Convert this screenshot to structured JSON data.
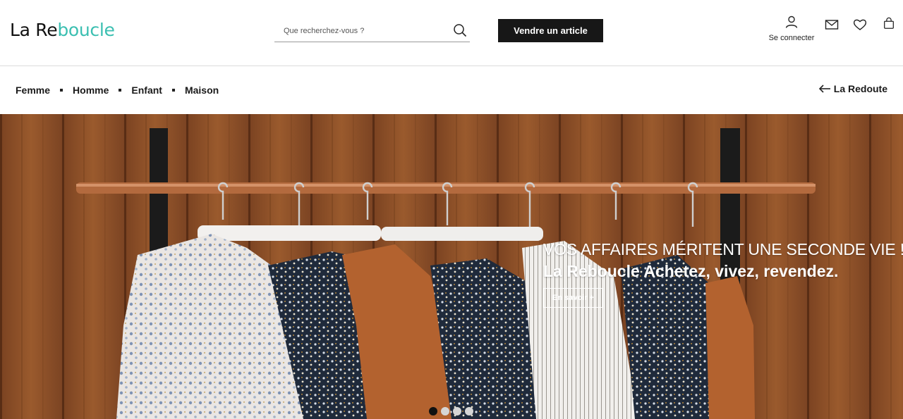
{
  "header": {
    "logo": {
      "part1": "La Re",
      "part2": "boucle"
    },
    "search": {
      "placeholder": "Que recherchez-vous ?"
    },
    "sell_button": "Vendre un article",
    "account_label": "Se connecter",
    "icons": [
      "user-icon",
      "mail-icon",
      "heart-icon",
      "bag-icon"
    ]
  },
  "nav": {
    "items": [
      {
        "label": "Femme"
      },
      {
        "label": "Homme"
      },
      {
        "label": "Enfant"
      },
      {
        "label": "Maison"
      }
    ],
    "back_link": "La Redoute"
  },
  "hero": {
    "title": "VOS AFFAIRES MÉRITENT UNE SECONDE VIE !",
    "subtitle": "La Reboucle Achetez, vivez, revendez.",
    "cta": "En savoir +",
    "slides": 4,
    "active_slide": 1
  },
  "colors": {
    "accent": "#3bbfb1",
    "button_dark": "#171717",
    "wood": "#8a4f26"
  }
}
